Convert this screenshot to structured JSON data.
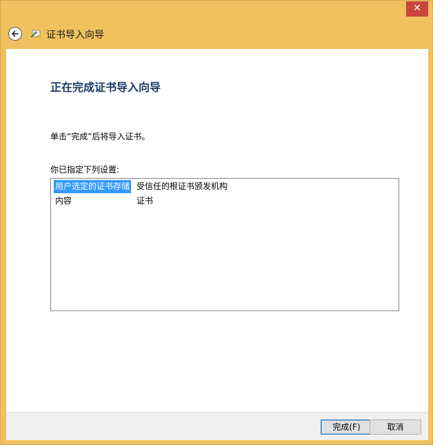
{
  "window": {
    "close_glyph": "✕",
    "title": "证书导入向导"
  },
  "page": {
    "heading": "正在完成证书导入向导",
    "description": "单击“完成”后将导入证书。",
    "list_label": "你已指定下列设置:"
  },
  "settings_list": {
    "rows": [
      {
        "name": "用户选定的证书存储",
        "value": "受信任的根证书颁发机构",
        "selected": true
      },
      {
        "name": "内容",
        "value": "证书",
        "selected": false
      }
    ]
  },
  "buttons": {
    "finish_label": "完成(F)",
    "cancel_label": "取消"
  },
  "icons": {
    "back": "back-arrow-icon",
    "wizard": "certificate-wizard-icon",
    "close": "close-icon"
  },
  "colors": {
    "frame": "#f0c15e",
    "close_button": "#c7463e",
    "heading": "#1a3b66",
    "selection": "#3399ff"
  }
}
